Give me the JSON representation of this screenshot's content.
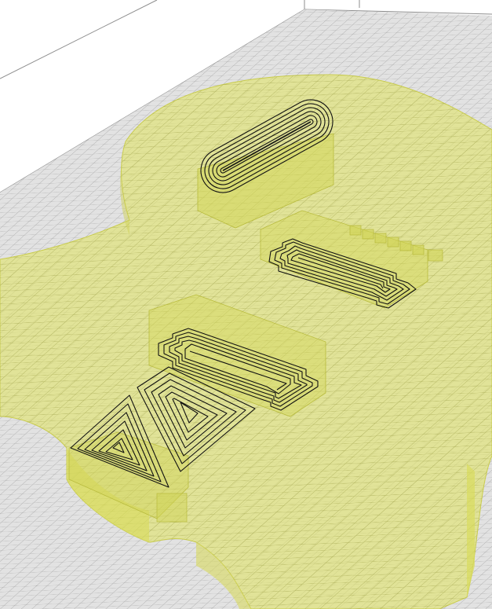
{
  "app": {
    "view": "3d-slicer-preview",
    "projection": "perspective"
  },
  "scene": {
    "background_color": "#ffffff",
    "bed_color": "#e2e2e2",
    "bed_grid_color": "#a9a9a9",
    "build_volume_edge_color": "#8c8c8c",
    "model_fill_color": "#e1e46a",
    "model_edge_color": "#bfc33a",
    "toolpath_color": "#111111",
    "grid": true
  },
  "model": {
    "shape": "guitar-body-plate",
    "transparency": "semi-transparent",
    "cutouts": [
      {
        "name": "neck-pickup-rout",
        "shape": "rounded-oval"
      },
      {
        "name": "bridge-pickup-rout",
        "shape": "stepped-rectangle"
      },
      {
        "name": "control-cavity-rout",
        "shape": "stepped-rectangle"
      },
      {
        "name": "triangle-cavity-left",
        "shape": "triangle"
      },
      {
        "name": "triangle-cavity-right",
        "shape": "triangle"
      }
    ]
  },
  "toolpaths": {
    "type": "concentric-perimeters"
  }
}
